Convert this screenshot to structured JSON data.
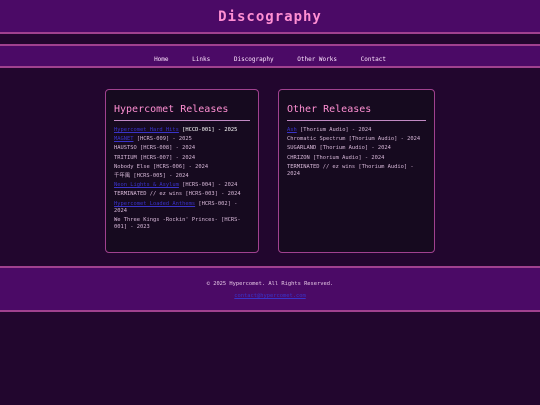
{
  "header": {
    "title": "Discography"
  },
  "nav": {
    "items": [
      {
        "label": "Home"
      },
      {
        "label": "Links"
      },
      {
        "label": "Discography"
      },
      {
        "label": "Other Works"
      },
      {
        "label": "Contact"
      }
    ]
  },
  "hypercomet": {
    "title": "Hypercomet Releases",
    "items": [
      {
        "link": "Hypercomet Hard Hits",
        "rest": "[HCCD-001] - 2025",
        "rest_highlight": true
      },
      {
        "link": "MAGNET",
        "rest": "[HCRS-009] - 2025"
      },
      {
        "link": "",
        "rest": "HAUSTSO [HCRS-008] - 2024"
      },
      {
        "link": "",
        "rest": "TRITIUM [HCRS-007] - 2024"
      },
      {
        "link": "",
        "rest": "Nobody Else [HCRS-006] - 2024"
      },
      {
        "link": "",
        "rest": "千年風 [HCRS-005] - 2024"
      },
      {
        "link": "Neon Lights & Asylum",
        "rest": "[HCRS-004] - 2024"
      },
      {
        "link": "",
        "rest": "TERMINATED // ez wins [HCRS-003] - 2024"
      },
      {
        "link": "Hypercomet Loaded Anthems",
        "rest": "[HCRS-002] - 2024"
      },
      {
        "link": "",
        "rest": "We Three Kings -Rockin' Princes- [HCRS-001] - 2023"
      }
    ]
  },
  "other": {
    "title": "Other Releases",
    "items": [
      {
        "link": "Ash",
        "rest": "[Thorium Audio] - 2024"
      },
      {
        "link": "",
        "rest": "Chromatic Spectrum [Thorium Audio] - 2024"
      },
      {
        "link": "",
        "rest": "SUGARLAND [Thorium Audio] - 2024"
      },
      {
        "link": "",
        "rest": "CHRIZON [Thorium Audio] - 2024"
      },
      {
        "link": "",
        "rest": "TERMINATED // ez wins [Thorium Audio] - 2024"
      }
    ]
  },
  "footer": {
    "copyright": "© 2025 Hypercomet. All Rights Reserved.",
    "contact_link": "contact@hypercomet.com"
  }
}
